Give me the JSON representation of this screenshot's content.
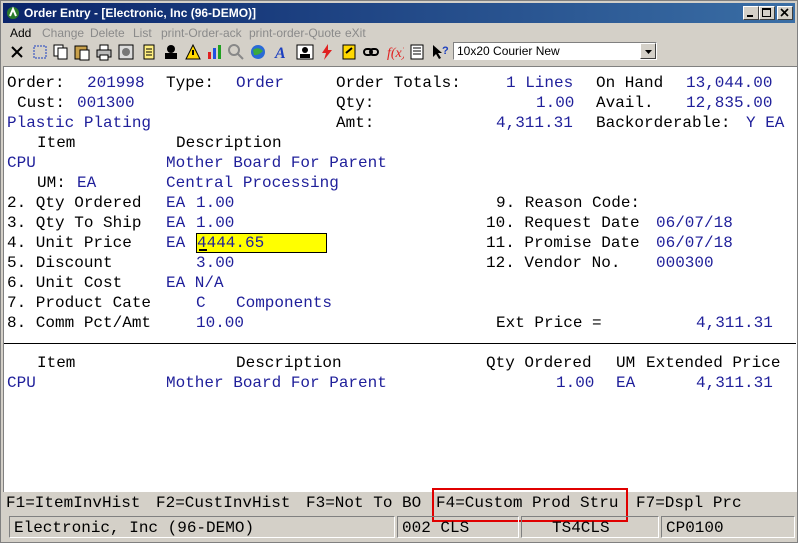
{
  "window": {
    "title": "Order Entry - [Electronic, Inc (96-DEMO)]",
    "title_color": "#0a246a"
  },
  "menu": {
    "items": [
      "Add",
      "Change",
      "Delete",
      "List",
      "print-Order-ack",
      "print-order-Quote",
      "eXit"
    ]
  },
  "toolbar": {
    "font_combo_value": "10x20 Courier New"
  },
  "header": {
    "order_label": "Order:",
    "order_value": "201998",
    "type_label": "Type:",
    "type_value": "Order",
    "cust_label": "Cust:",
    "cust_value": "001300",
    "cust_name": "Plastic Plating",
    "order_totals_label": "Order Totals:",
    "lines_value": "1 Lines",
    "qty_label": "Qty:",
    "qty_value": "1.00",
    "amt_label": "Amt:",
    "amt_value": "4,311.31",
    "on_hand_label": "On Hand",
    "on_hand_value": "13,044.00",
    "avail_label": "Avail.",
    "avail_value": "12,835.00",
    "backorderable_label": "Backorderable:",
    "backorderable_value": "Y EA"
  },
  "line_detail": {
    "item_header": "Item",
    "description_header": "Description",
    "item": "CPU",
    "description1": "Mother Board For Parent",
    "um_label": "UM:",
    "um_value": "EA",
    "description2": "Central Processing",
    "f2_label": "2. Qty Ordered",
    "f2_um": "EA",
    "f2_value": "1.00",
    "f3_label": "3. Qty To Ship",
    "f3_um": "EA",
    "f3_value": "1.00",
    "f4_label": "4. Unit Price",
    "f4_um": "EA",
    "f4_value": "4444.65",
    "f5_label": "5. Discount",
    "f5_value": "3.00",
    "f6_label": "6. Unit Cost",
    "f6_value": "EA N/A",
    "f7_label": "7. Product Cate",
    "f7_code": "C",
    "f7_name": "Components",
    "f8_label": "8. Comm Pct/Amt",
    "f8_value": "10.00",
    "f9_label": "9. Reason Code:",
    "f10_label": "10. Request Date",
    "f10_value": "06/07/18",
    "f11_label": "11. Promise Date",
    "f11_value": "06/07/18",
    "f12_label": "12. Vendor No.",
    "f12_value": "000300",
    "ext_price_label": "Ext Price =",
    "ext_price_value": "4,311.31"
  },
  "lines_table": {
    "headers": {
      "item": "Item",
      "description": "Description",
      "qty_ordered": "Qty Ordered",
      "um": "UM",
      "extended_price": "Extended Price"
    },
    "rows": [
      {
        "item": "CPU",
        "description": "Mother Board For Parent",
        "qty_ordered": "1.00",
        "um": "EA",
        "extended_price": "4,311.31"
      }
    ]
  },
  "function_keys": {
    "f1": "F1=ItemInvHist",
    "f2": "F2=CustInvHist",
    "f3": "F3=Not To BO",
    "f4": "F4=Custom Prod Stru",
    "f7": "F7=Dspl Prc",
    "highlight_color": "#e00000"
  },
  "status_bar": {
    "company": "Electronic, Inc (96-DEMO)",
    "code1": "002 CLS",
    "code2": "TS4CLS",
    "code3": "CP0100"
  },
  "colors": {
    "field_text": "#1f1f9a",
    "input_highlight": "#ffff00",
    "terminal_bg": "#ffffff",
    "chrome_bg": "#d4d0c8"
  }
}
